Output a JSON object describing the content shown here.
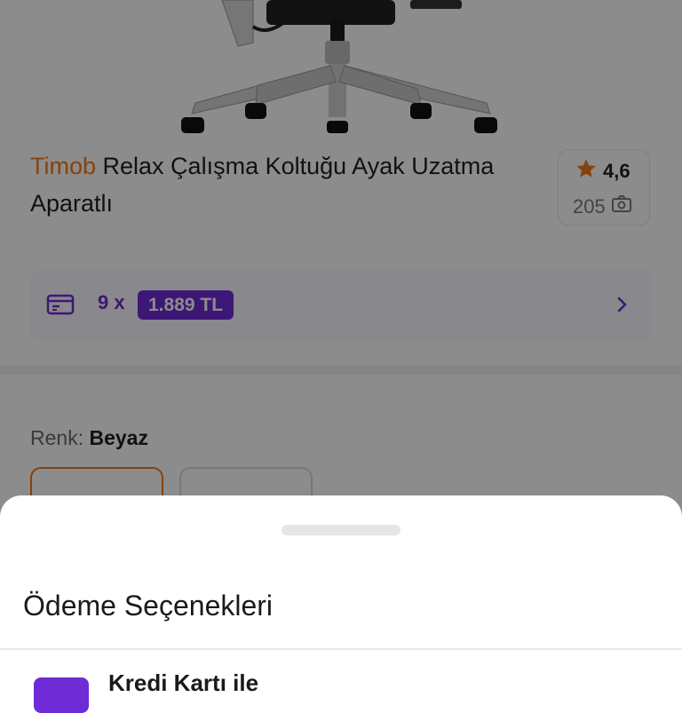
{
  "product": {
    "brand": "Timob",
    "name": "Relax Çalışma Koltuğu Ayak Uzatma Aparatlı",
    "rating": "4,6",
    "review_count": "205"
  },
  "installment": {
    "count": "9 x",
    "price": "1.889 TL"
  },
  "color": {
    "label": "Renk:",
    "value": "Beyaz"
  },
  "sheet": {
    "title": "Ödeme Seçenekleri",
    "option_label": "Kredi Kartı ile"
  },
  "colors": {
    "brand_orange": "#f27a1a",
    "accent_purple": "#6f2bd6",
    "overlay": "rgba(0,0,0,0.45)"
  },
  "icons": {
    "rating": "star-icon",
    "reviews": "camera-icon",
    "installment": "credit-card-icon",
    "navigate": "chevron-right-icon"
  }
}
